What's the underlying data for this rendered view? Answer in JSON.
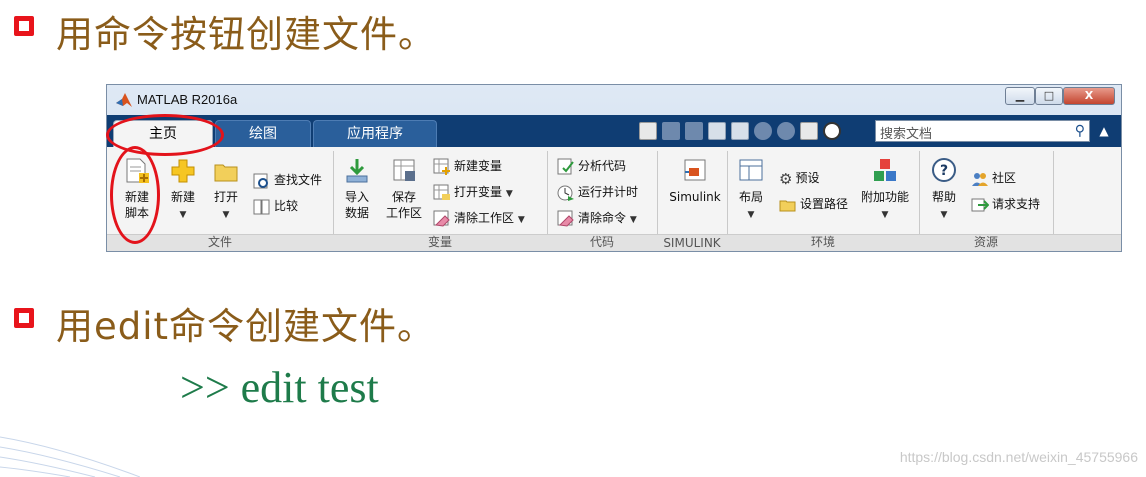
{
  "slide": {
    "heading1": "用命令按钮创建文件。",
    "heading2": "用edit命令创建文件。",
    "command": ">> edit test",
    "watermark": "https://blog.csdn.net/weixin_45755966"
  },
  "window": {
    "title": "MATLAB R2016a",
    "controls": {
      "minimize": "▁",
      "maximize": "□",
      "close": "X"
    }
  },
  "tabs": [
    {
      "label": "主页",
      "active": true
    },
    {
      "label": "绘图",
      "active": false
    },
    {
      "label": "应用程序",
      "active": false
    }
  ],
  "search": {
    "placeholder": "搜索文档"
  },
  "ribbon": {
    "file": {
      "label": "文件",
      "new_script": "新建\n脚本",
      "new": "新建",
      "open": "打开",
      "find_files": "查找文件",
      "compare": "比较"
    },
    "variable": {
      "label": "变量",
      "import_data": "导入\n数据",
      "save_workspace": "保存\n工作区",
      "new_variable": "新建变量",
      "open_variable": "打开变量",
      "clear_workspace": "清除工作区"
    },
    "code": {
      "label": "代码",
      "analyze_code": "分析代码",
      "run_and_time": "运行并计时",
      "clear_commands": "清除命令"
    },
    "simulink": {
      "label": "SIMULINK",
      "button": "Simulink"
    },
    "environment": {
      "label": "环境",
      "layout": "布局",
      "preferences": "预设",
      "set_path": "设置路径",
      "add_ons": "附加功能"
    },
    "resources": {
      "label": "资源",
      "help": "帮助",
      "community": "社区",
      "request_support": "请求支持"
    }
  },
  "colors": {
    "bullet": "#e8141b",
    "heading": "#8a5c1a",
    "command": "#1e7b4a",
    "tabbar": "#0f3d73",
    "annotation": "#e3131b"
  }
}
